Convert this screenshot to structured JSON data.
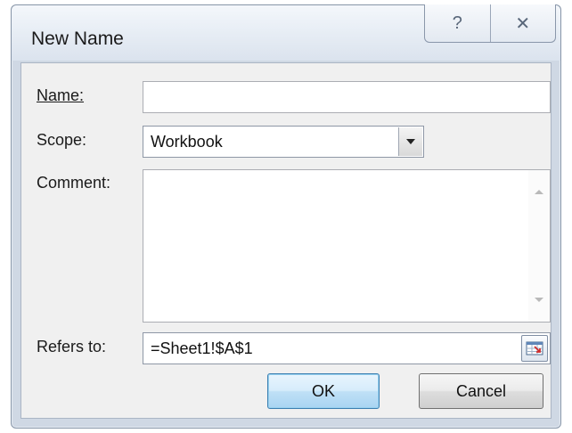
{
  "window": {
    "title": "New Name",
    "help_glyph": "?",
    "close_glyph": "✕"
  },
  "form": {
    "name_label": "Name:",
    "name_value": "",
    "scope_label": "Scope:",
    "scope_value": "Workbook",
    "comment_label": "Comment:",
    "comment_value": "",
    "refers_label": "Refers to:",
    "refers_value": "=Sheet1!$A$1"
  },
  "buttons": {
    "ok_label": "OK",
    "cancel_label": "Cancel"
  },
  "icons": {
    "help": "help-icon",
    "close": "close-icon",
    "dropdown": "chevron-down-icon",
    "scroll_up": "scroll-up-icon",
    "scroll_down": "scroll-down-icon",
    "range_picker": "collapse-dialog-icon"
  }
}
